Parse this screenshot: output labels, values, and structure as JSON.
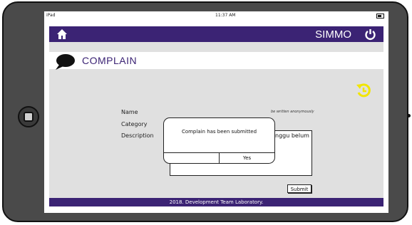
{
  "status_bar": {
    "device": "iPad",
    "time": "11:37 AM"
  },
  "navbar": {
    "title": "SIMMO",
    "home_icon": "home-icon",
    "power_icon": "power-icon",
    "color": "#3b2374"
  },
  "page": {
    "title": "COMPLAIN",
    "title_icon": "speech-bubble-icon",
    "refresh_icon": "refresh-icon"
  },
  "form": {
    "name_label": "Name",
    "category_label": "Category",
    "description_label": "Description",
    "anonymous_hint": "be written anonymously",
    "description_value": "minggu belum",
    "submit_label": "Submit"
  },
  "modal": {
    "message": "Complain has been submitted",
    "confirm_label": "Yes"
  },
  "footer": {
    "text": "2018. Development Team Laboratory."
  },
  "colors": {
    "accent": "#3b2374",
    "refresh": "#f2e600",
    "content_bg": "#e0e0e0"
  }
}
